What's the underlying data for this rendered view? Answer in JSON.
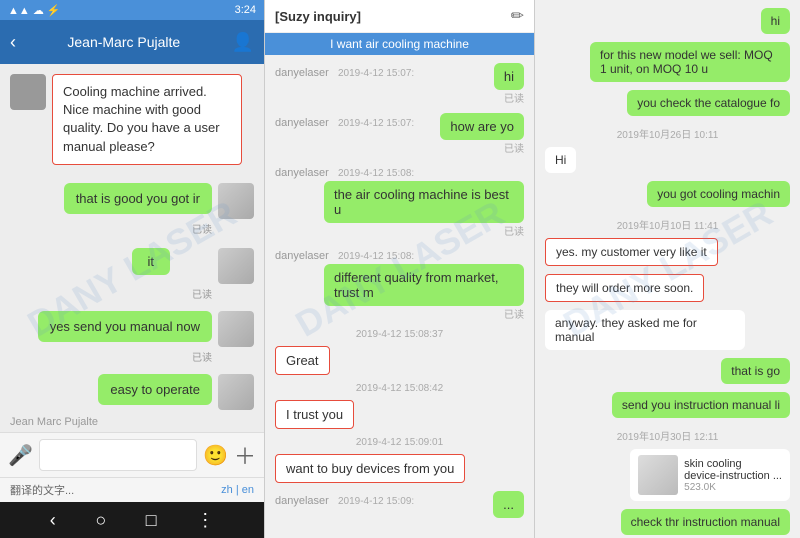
{
  "statusBar": {
    "time": "3:24",
    "icons": "signal wifi battery"
  },
  "leftPanel": {
    "headerName": "Jean-Marc Pujalte",
    "messages": [
      {
        "type": "received_outlined",
        "text": "Cooling machine arrived. Nice machine with good quality. Do you have a user manual please?"
      },
      {
        "type": "sent",
        "text": "that is good you got ir",
        "status": "已读"
      },
      {
        "type": "sent_small",
        "text": "it",
        "status": "已读"
      },
      {
        "type": "sent",
        "text": "yes send you manual now",
        "status": "已读"
      },
      {
        "type": "sent",
        "text": "easy to operate",
        "status": "已读"
      }
    ],
    "inputPlaceholder": "翻译的文字...",
    "langZh": "zh",
    "langEn": "en"
  },
  "middlePanel": {
    "title": "[Suzy inquiry]",
    "topMessage": "I want air cooling machine",
    "messages": [
      {
        "sender": "danyelaser",
        "time": "2019-4-12 15:07:",
        "text": "hi",
        "type": "sent",
        "status": "已读"
      },
      {
        "sender": "danyelaser",
        "time": "2019-4-12 15:07:",
        "text": "how are yo",
        "type": "sent",
        "status": "已读"
      },
      {
        "sender": "danyelaser",
        "time": "2019-4-12 15:08:",
        "text": "the air cooling machine is best u",
        "type": "sent",
        "status": "已读"
      },
      {
        "sender": "danyelaser",
        "time": "2019-4-12 15:08:",
        "text": "different quality from market, trust m",
        "type": "sent",
        "status": "已读"
      },
      {
        "time": "2019-4-12 15:08:37",
        "text": "Great",
        "type": "received_outlined"
      },
      {
        "time": "2019-4-12 15:08:42",
        "text": "I trust you",
        "type": "received_outlined"
      },
      {
        "time": "2019-4-12 15:09:01",
        "text": "want to buy devices from you",
        "type": "received_outlined"
      },
      {
        "sender": "danyelaser",
        "time": "2019-4-12 15:09:",
        "text": "...",
        "type": "sent"
      }
    ]
  },
  "rightPanel": {
    "messages": [
      {
        "type": "sent",
        "text": "hi",
        "align": "right"
      },
      {
        "type": "sent",
        "text": "for this new model we sell: MOQ 1 unit, on MOQ 10 u",
        "align": "right"
      },
      {
        "type": "sent",
        "text": "you check the catalogue fo",
        "align": "right"
      },
      {
        "time": "2019年10月26日 10:11",
        "type": "time"
      },
      {
        "type": "received",
        "text": "Hi"
      },
      {
        "type": "sent",
        "text": "you got cooling machin",
        "align": "right"
      },
      {
        "time": "2019年10月10日 11:41",
        "type": "time"
      },
      {
        "type": "received_outlined",
        "text": "yes. my customer very like it"
      },
      {
        "type": "received_outlined",
        "text": "they will order more soon."
      },
      {
        "type": "received",
        "text": "anyway. they asked me for manual"
      },
      {
        "type": "sent",
        "text": "that is go",
        "align": "right"
      },
      {
        "type": "sent",
        "text": "send you instruction manual li",
        "align": "right"
      },
      {
        "time": "2019年10月30日 12:11",
        "type": "time"
      },
      {
        "type": "product_card",
        "name": "skin cooling device-instruction ...",
        "size": "523.0K",
        "align": "right"
      },
      {
        "type": "sent",
        "text": "check thr instruction manual",
        "align": "right"
      }
    ]
  },
  "watermark": "DANY LASER"
}
